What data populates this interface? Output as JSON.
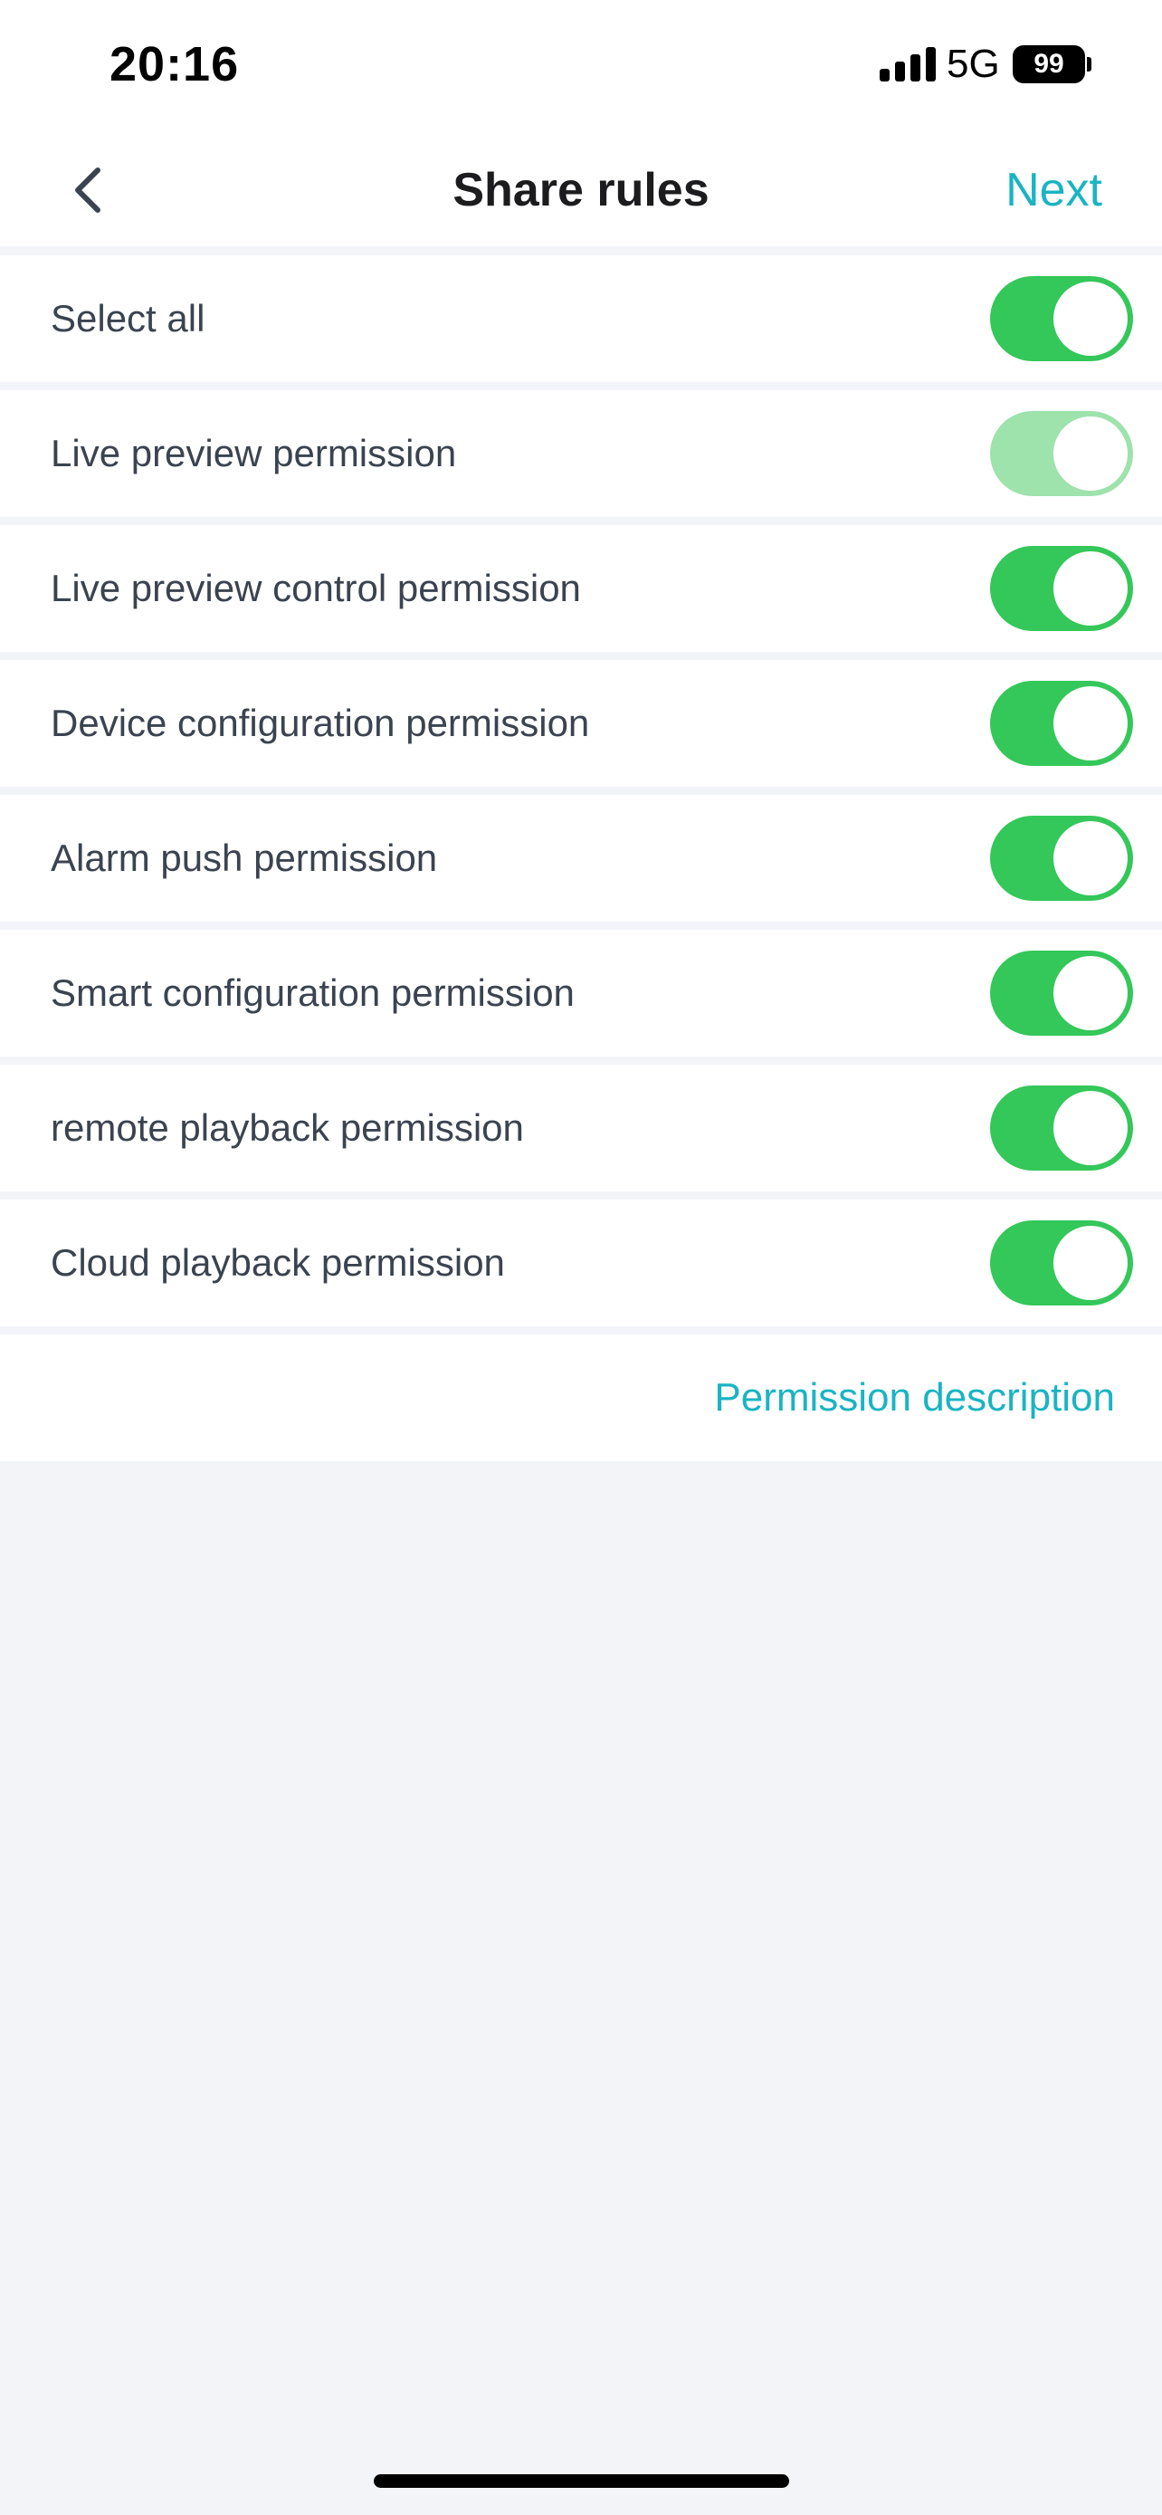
{
  "status_bar": {
    "time": "20:16",
    "network": "5G",
    "battery": "99"
  },
  "nav": {
    "title": "Share rules",
    "next_label": "Next",
    "back_icon": "chevron-left-icon"
  },
  "permissions": [
    {
      "label": "Select all",
      "enabled": true
    },
    {
      "label": "Live preview permission",
      "enabled": true,
      "disabled_look": true
    },
    {
      "label": "Live preview control permission",
      "enabled": true
    },
    {
      "label": "Device configuration permission",
      "enabled": true
    },
    {
      "label": "Alarm push permission",
      "enabled": true
    },
    {
      "label": "Smart configuration permission",
      "enabled": true
    },
    {
      "label": "remote playback permission",
      "enabled": true
    },
    {
      "label": "Cloud playback permission",
      "enabled": true
    }
  ],
  "permission_description_label": "Permission description",
  "colors": {
    "accent": "#1ab4c3",
    "toggle_on": "#34c759",
    "toggle_on_disabled": "#9ee2ac",
    "background": "#f2f4f8"
  }
}
